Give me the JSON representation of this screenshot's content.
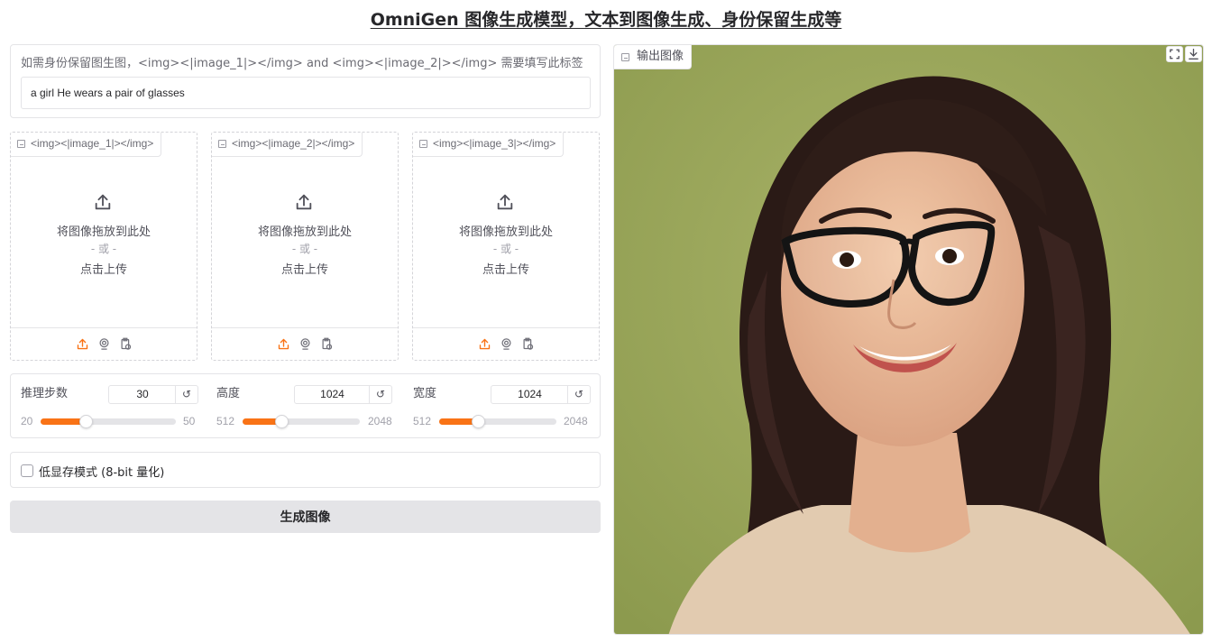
{
  "header": {
    "title": "OmniGen 图像生成模型，文本到图像生成、身份保留生成等"
  },
  "prompt": {
    "label": "如需身份保留图生图，<img><|image_1|></img> and <img><|image_2|></img> 需要填写此标签",
    "value": "a girl He wears a pair of glasses"
  },
  "image_inputs": [
    {
      "tag": "<img><|image_1|></img>",
      "drop_text": "将图像拖放到此处",
      "or_text": "- 或 -",
      "click_text": "点击上传"
    },
    {
      "tag": "<img><|image_2|></img>",
      "drop_text": "将图像拖放到此处",
      "or_text": "- 或 -",
      "click_text": "点击上传"
    },
    {
      "tag": "<img><|image_3|></img>",
      "drop_text": "将图像拖放到此处",
      "or_text": "- 或 -",
      "click_text": "点击上传"
    }
  ],
  "sliders": [
    {
      "label": "推理步数",
      "value": "30",
      "min": "20",
      "max": "50",
      "fraction": 0.333
    },
    {
      "label": "高度",
      "value": "1024",
      "min": "512",
      "max": "2048",
      "fraction": 0.333
    },
    {
      "label": "宽度",
      "value": "1024",
      "min": "512",
      "max": "2048",
      "fraction": 0.333
    }
  ],
  "low_memory": {
    "label": "低显存模式 (8-bit 量化)",
    "checked": false
  },
  "generate_button": {
    "label": "生成图像"
  },
  "output": {
    "label": "输出图像",
    "image_description": "portrait-of-smiling-woman-with-glasses"
  },
  "colors": {
    "accent": "#f97316",
    "button_bg": "#e4e4e7",
    "output_bg": "#9aa65a"
  },
  "icons": [
    "image-icon",
    "upload-icon",
    "webcam-icon",
    "clipboard-icon",
    "fullscreen-icon",
    "download-icon",
    "reset-icon"
  ]
}
